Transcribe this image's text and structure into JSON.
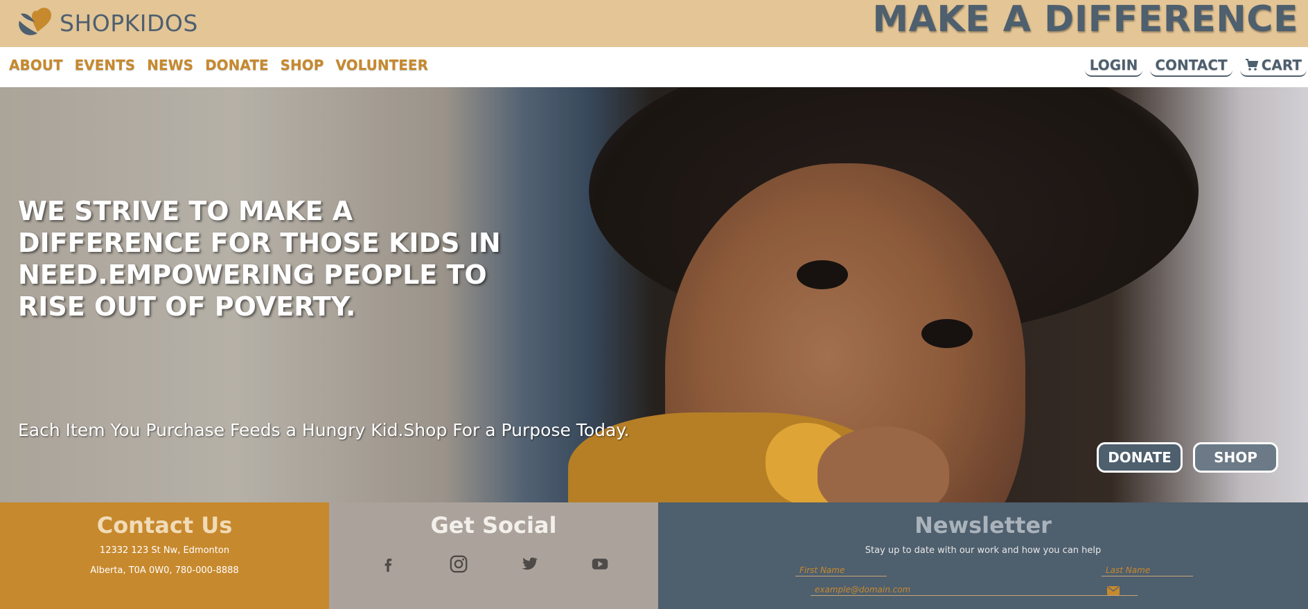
{
  "brand": {
    "name": "SHOPKIDOS",
    "tagline": "MAKE A DIFFERENCE"
  },
  "nav": {
    "left": [
      "ABOUT",
      "EVENTS",
      "NEWS",
      "DONATE",
      "SHOP",
      "VOLUNTEER"
    ],
    "right": {
      "login": "LOGIN",
      "contact": "CONTACT",
      "cart": "CART"
    }
  },
  "hero": {
    "headline": "WE STRIVE TO MAKE A DIFFERENCE FOR THOSE KIDS IN NEED.EMPOWERING PEOPLE TO RISE OUT OF POVERTY.",
    "subline": "Each Item You Purchase Feeds a Hungry Kid.Shop For a Purpose Today.",
    "donate_button": "DONATE",
    "shop_button": "SHOP"
  },
  "footer": {
    "contact": {
      "title": "Contact Us",
      "address_line1": "12332 123 St Nw, Edmonton",
      "address_line2": "Alberta, T0A 0W0, 780-000-8888"
    },
    "social": {
      "title": "Get Social",
      "icons": [
        "facebook-icon",
        "instagram-icon",
        "twitter-icon",
        "youtube-icon"
      ]
    },
    "newsletter": {
      "title": "Newsletter",
      "subtitle": "Stay up to date with our work and how you can help",
      "first_name_placeholder": "First Name",
      "last_name_placeholder": "Last Name",
      "email_placeholder": "example@domain.com"
    }
  },
  "colors": {
    "banner": "#e3c596",
    "slate": "#4e5f6e",
    "gold": "#c7892d",
    "taupe": "#aba39b"
  }
}
